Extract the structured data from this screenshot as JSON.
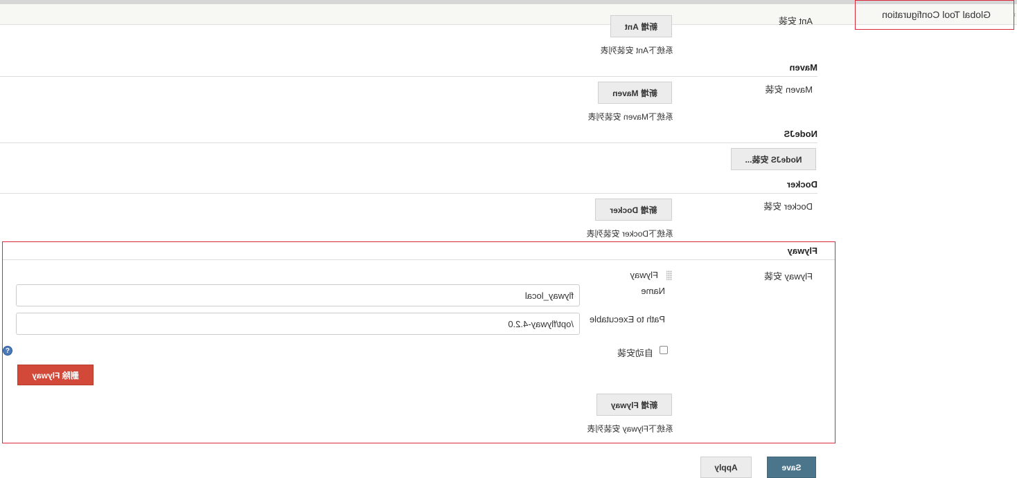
{
  "breadcrumb": {
    "current": "Global Tool Configuration"
  },
  "ant": {
    "install_label": "Ant 安装",
    "add_button": "新增 Ant",
    "hint": "系统下Ant 安装列表"
  },
  "maven": {
    "title": "Maven",
    "install_label": "Maven 安装",
    "add_button": "新增 Maven",
    "hint": "系统下Maven 安装列表"
  },
  "nodejs": {
    "title": "NodeJS",
    "add_button": "NodeJS 安装..."
  },
  "docker": {
    "title": "Docker",
    "install_label": "Docker 安装",
    "add_button": "新增 Docker",
    "hint": "系统下Docker 安装列表"
  },
  "flyway": {
    "title": "Flyway",
    "install_label": "Flyway 安装",
    "entry_label": "Flyway",
    "name_label": "Name",
    "name_value": "flyway_local",
    "path_label": "Path to Executable",
    "path_value": "/opt/flyway-4.2.0",
    "auto_install_label": "自动安装",
    "delete_button": "删除 Flyway",
    "add_button": "新增 Flyway",
    "hint": "系统下Flyway 安装列表"
  },
  "footer": {
    "save_button": "Save",
    "apply_button": "Apply"
  },
  "icons": {
    "help": "help-icon",
    "grip": "drag-handle-icon"
  },
  "colors": {
    "highlight_border": "#d9263a",
    "delete_button": "#d24939",
    "save_button": "#4b758b",
    "help_icon": "#4c79b9"
  }
}
